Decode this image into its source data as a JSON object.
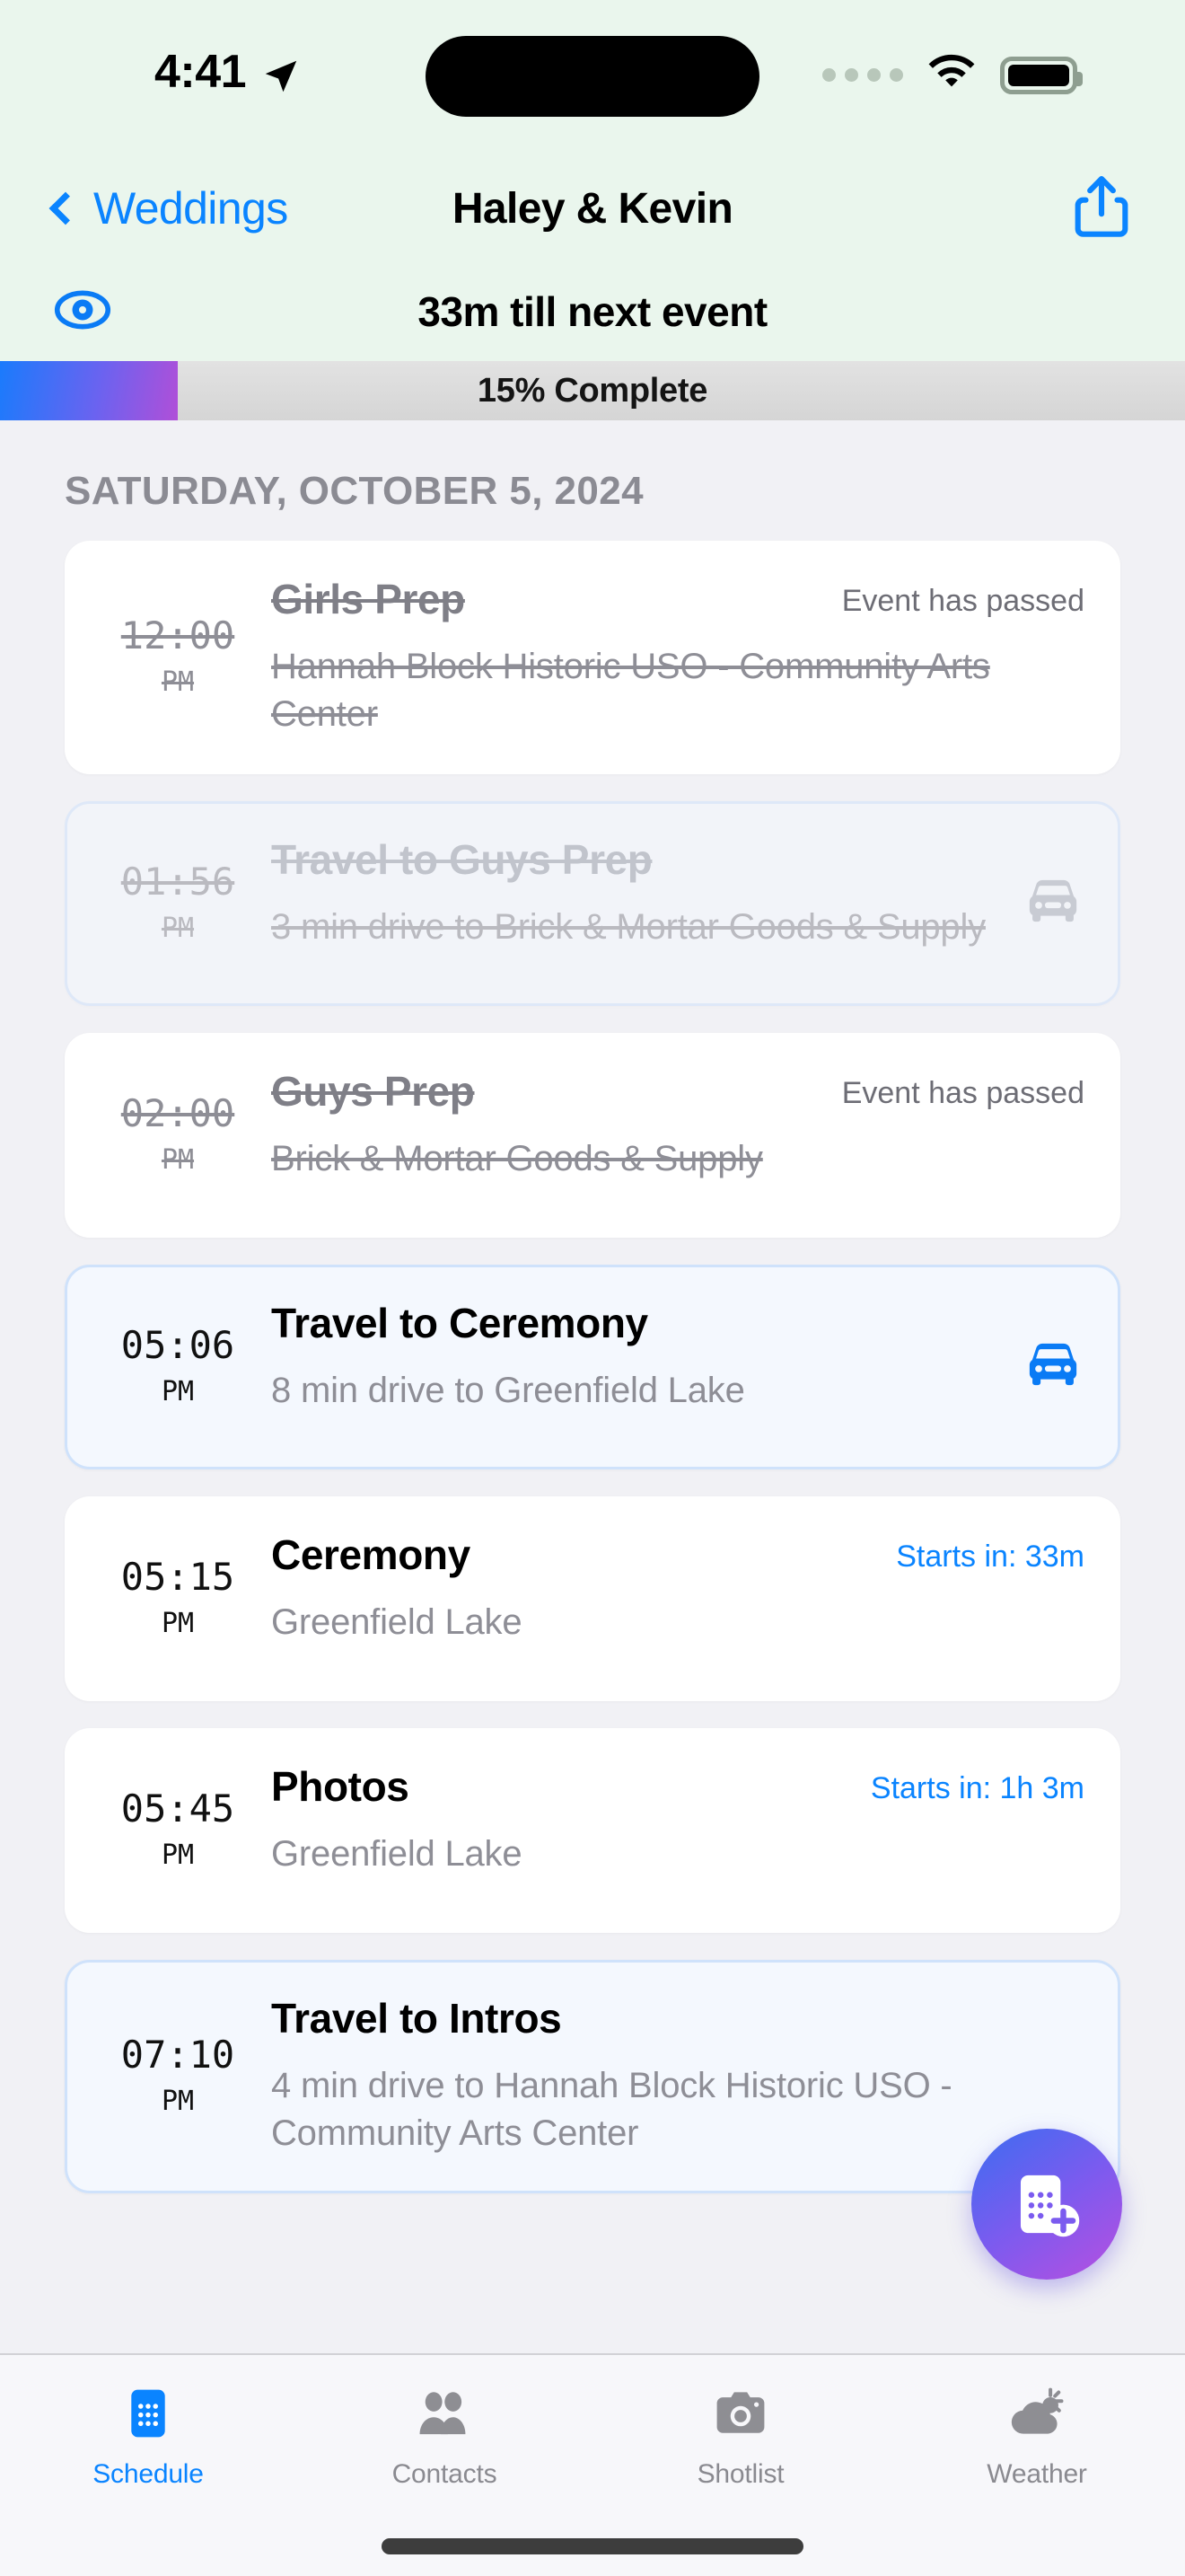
{
  "status_bar": {
    "time": "4:41",
    "location_icon": "location-arrow-icon",
    "signal_icon": "signal-dots-icon",
    "wifi_icon": "wifi-icon",
    "battery_icon": "battery-full-icon"
  },
  "nav": {
    "back_label": "Weddings",
    "title": "Haley & Kevin",
    "share_icon": "share-icon"
  },
  "subheader": {
    "eye_icon": "eye-icon",
    "countdown": "33m till next event"
  },
  "progress": {
    "label": "15% Complete",
    "percent": 15,
    "fill_start_color": "#1a7bfc",
    "fill_end_color": "#b04fd8",
    "track_color": "#dadada"
  },
  "schedule": {
    "date_header": "SATURDAY, OCTOBER 5, 2024",
    "events": [
      {
        "time": "12:00",
        "ampm": "PM",
        "title": "Girls Prep",
        "subtitle": "Hannah Block Historic USO - Community Arts Center",
        "status": "Event has passed",
        "passed": true,
        "travel": false,
        "icon": ""
      },
      {
        "time": "01:56",
        "ampm": "PM",
        "title": "Travel to Guys Prep",
        "subtitle": "3 min drive to Brick & Mortar Goods & Supply",
        "status": "",
        "passed": true,
        "travel": true,
        "icon": "car-icon"
      },
      {
        "time": "02:00",
        "ampm": "PM",
        "title": "Guys Prep",
        "subtitle": "Brick & Mortar Goods & Supply",
        "status": "Event has passed",
        "passed": true,
        "travel": false,
        "icon": ""
      },
      {
        "time": "05:06",
        "ampm": "PM",
        "title": "Travel to Ceremony",
        "subtitle": "8 min drive to Greenfield Lake",
        "status": "",
        "passed": false,
        "travel": true,
        "icon": "car-icon"
      },
      {
        "time": "05:15",
        "ampm": "PM",
        "title": "Ceremony",
        "subtitle": "Greenfield Lake",
        "status": "Starts in: 33m",
        "passed": false,
        "travel": false,
        "icon": ""
      },
      {
        "time": "05:45",
        "ampm": "PM",
        "title": "Photos",
        "subtitle": "Greenfield Lake",
        "status": "Starts in: 1h 3m",
        "passed": false,
        "travel": false,
        "icon": ""
      },
      {
        "time": "07:10",
        "ampm": "PM",
        "title": "Travel to Intros",
        "subtitle": "4 min drive to Hannah Block Historic USO - Community Arts Center",
        "status": "",
        "passed": false,
        "travel": true,
        "icon": ""
      }
    ]
  },
  "fab": {
    "icon": "calendar-plus-icon",
    "gradient_start": "#3b6df0",
    "gradient_end": "#b74fe0"
  },
  "tabbar": {
    "active_color": "#0a84ff",
    "inactive_color": "#8a8a90",
    "tabs": [
      {
        "label": "Schedule",
        "icon": "calendar-icon",
        "active": true
      },
      {
        "label": "Contacts",
        "icon": "people-icon",
        "active": false
      },
      {
        "label": "Shotlist",
        "icon": "camera-icon",
        "active": false
      },
      {
        "label": "Weather",
        "icon": "cloud-sun-icon",
        "active": false
      }
    ]
  }
}
